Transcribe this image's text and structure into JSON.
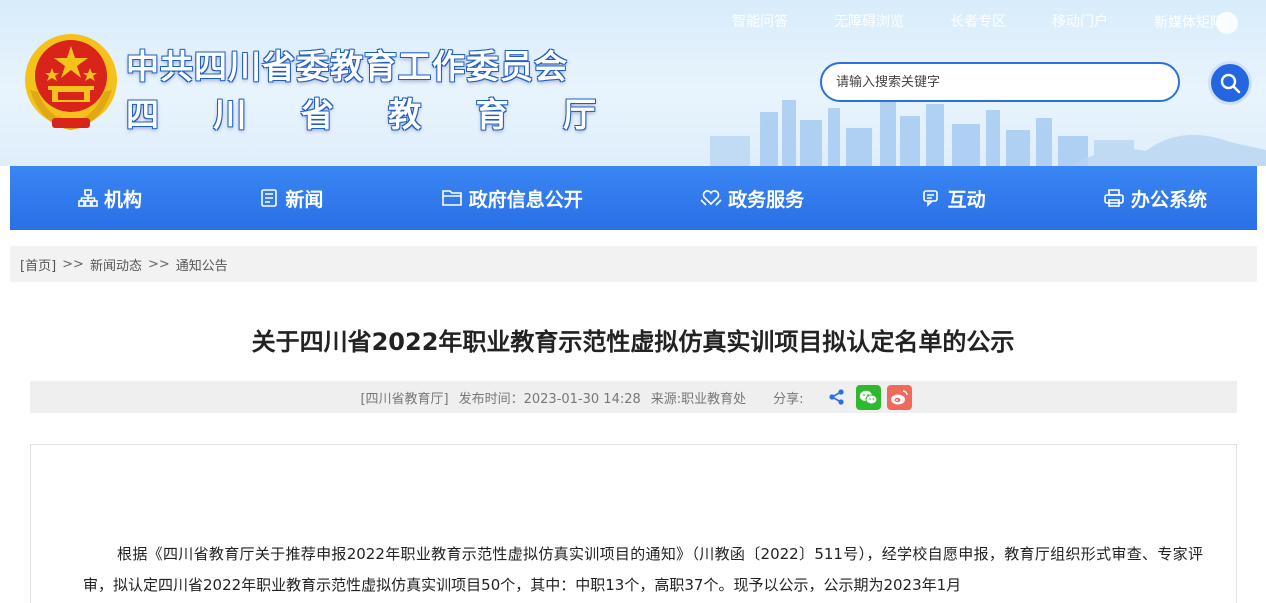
{
  "header": {
    "title_main": "中共四川省委教育工作委员会",
    "title_sub_chars": [
      "四",
      "川",
      "省",
      "教",
      "育",
      "厅"
    ],
    "top_links": [
      "智能问答",
      "无障碍浏览",
      "长者专区",
      "移动门户",
      "新媒体矩阵"
    ],
    "search": {
      "placeholder": "请输入搜索关键字",
      "value": ""
    }
  },
  "nav": [
    {
      "label": "机构",
      "icon": "org-chart-icon"
    },
    {
      "label": "新闻",
      "icon": "news-icon"
    },
    {
      "label": "政府信息公开",
      "icon": "folder-icon"
    },
    {
      "label": "政务服务",
      "icon": "heart-hands-icon"
    },
    {
      "label": "互动",
      "icon": "chat-icon"
    },
    {
      "label": "办公系统",
      "icon": "printer-icon"
    }
  ],
  "breadcrumb": {
    "home": "[首页]",
    "sep": ">>",
    "level1": "新闻动态",
    "level2": "通知公告"
  },
  "article": {
    "title": "关于四川省2022年职业教育示范性虚拟仿真实训项目拟认定名单的公示",
    "publisher": "[四川省教育厅]",
    "publish_time": "发布时间：2023-01-30 14:28",
    "source": "来源:职业教育处",
    "share_label": "分享:",
    "body": "根据《四川省教育厅关于推荐申报2022年职业教育示范性虚拟仿真实训项目的通知》（川教函〔2022〕511号），经学校自愿申报，教育厅组织形式审查、专家评审，拟认定四川省2022年职业教育示范性虚拟仿真实训项目50个，其中：中职13个，高职37个。现予以公示，公示期为2023年1月"
  },
  "colors": {
    "nav_blue": "#2a6fe6",
    "title_outline": "#1f5fc5",
    "emblem_red": "#d9241c",
    "emblem_gold": "#f5c21b"
  }
}
